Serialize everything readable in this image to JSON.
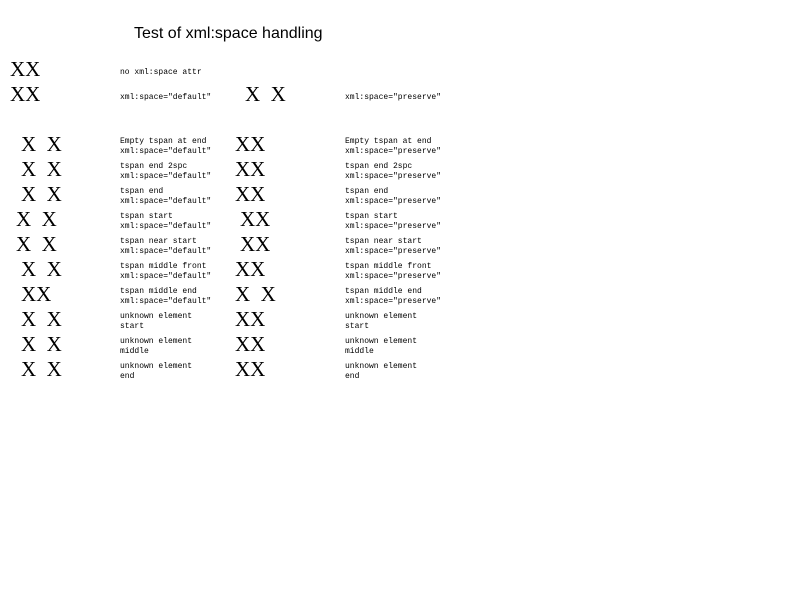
{
  "title": "Test of xml:space handling",
  "rows": [
    {
      "left": {
        "xx": "XX",
        "label": [
          "no xml:space attr"
        ]
      }
    },
    {
      "left": {
        "xx": "XX",
        "label": [
          "xml:space=\"default\""
        ]
      },
      "right": {
        "xx": "X  X",
        "label": [
          "xml:space=\"preserve\""
        ]
      }
    },
    {
      "left": {
        "xx": "X  X",
        "label": [
          "Empty tspan at end",
          "xml:space=\"default\""
        ]
      },
      "right": {
        "xx": "XX",
        "label": [
          "Empty tspan at end",
          "xml:space=\"preserve\""
        ]
      }
    },
    {
      "left": {
        "xx": "X  X",
        "label": [
          "tspan end 2spc",
          "xml:space=\"default\""
        ]
      },
      "right": {
        "xx": "XX",
        "label": [
          "tspan end 2spc",
          "xml:space=\"preserve\""
        ]
      }
    },
    {
      "left": {
        "xx": "X  X",
        "label": [
          "tspan end",
          "xml:space=\"default\""
        ]
      },
      "right": {
        "xx": "XX",
        "label": [
          "tspan end",
          "xml:space=\"preserve\""
        ]
      }
    },
    {
      "left": {
        "xx": "X  X",
        "label": [
          "tspan start",
          "xml:space=\"default\""
        ]
      },
      "right": {
        "xx": "XX",
        "label": [
          "tspan start",
          "xml:space=\"preserve\""
        ]
      }
    },
    {
      "left": {
        "xx": "X  X",
        "label": [
          "tspan near start",
          "xml:space=\"default\""
        ]
      },
      "right": {
        "xx": "XX",
        "label": [
          "tspan near start",
          "xml:space=\"preserve\""
        ]
      }
    },
    {
      "left": {
        "xx": "X  X",
        "label": [
          "tspan middle front",
          "xml:space=\"default\""
        ]
      },
      "right": {
        "xx": "XX",
        "label": [
          "tspan middle front",
          "xml:space=\"preserve\""
        ]
      }
    },
    {
      "left": {
        "xx": "XX",
        "label": [
          "tspan middle end",
          "xml:space=\"default\""
        ]
      },
      "right": {
        "xx": "X  X",
        "label": [
          "tspan middle end",
          "xml:space=\"preserve\""
        ]
      }
    },
    {
      "left": {
        "xx": "X  X",
        "label": [
          "unknown element",
          "start"
        ]
      },
      "right": {
        "xx": "XX",
        "label": [
          "unknown element",
          "start"
        ]
      }
    },
    {
      "left": {
        "xx": "X  X",
        "label": [
          "unknown element",
          "middle"
        ]
      },
      "right": {
        "xx": "XX",
        "label": [
          "unknown element",
          "middle"
        ]
      }
    },
    {
      "left": {
        "xx": "X  X",
        "label": [
          "unknown element",
          "end"
        ]
      },
      "right": {
        "xx": "XX",
        "label": [
          "unknown element",
          "end"
        ]
      }
    }
  ]
}
